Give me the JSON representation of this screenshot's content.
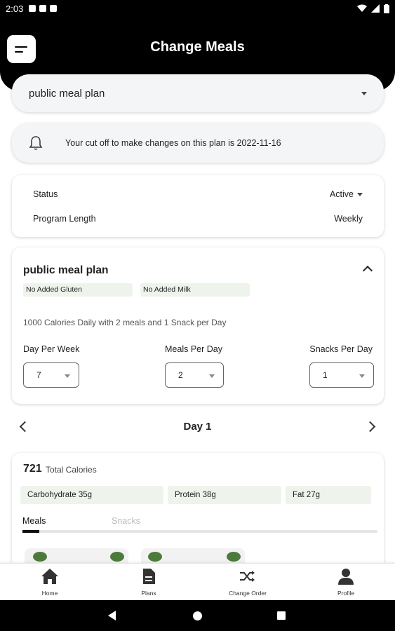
{
  "status_bar": {
    "time": "2:03"
  },
  "header": {
    "title": "Change Meals"
  },
  "plan_select": {
    "value": "public meal plan"
  },
  "cutoff": {
    "text": "Your cut off to make changes on this plan is 2022-11-16"
  },
  "status_card": {
    "status_label": "Status",
    "status_value": "Active",
    "length_label": "Program Length",
    "length_value": "Weekly"
  },
  "plan_card": {
    "title": "public meal plan",
    "tags": [
      "No Added Gluten",
      "No Added Milk"
    ],
    "description": "1000 Calories Daily with 2 meals and 1 Snack per Day",
    "fields": [
      {
        "label": "Day Per Week",
        "value": "7"
      },
      {
        "label": "Meals Per Day",
        "value": "2"
      },
      {
        "label": "Snacks Per Day",
        "value": "1"
      }
    ]
  },
  "day_nav": {
    "label": "Day 1"
  },
  "calories": {
    "value": "721",
    "label": "Total Calories",
    "macros": [
      "Carbohydrate 35g",
      "Protein 38g",
      "Fat 27g"
    ],
    "tabs": [
      "Meals",
      "Snacks"
    ]
  },
  "bottom_nav": [
    {
      "label": "Home",
      "icon": "home-icon"
    },
    {
      "label": "Plans",
      "icon": "document-icon"
    },
    {
      "label": "Change Order",
      "icon": "shuffle-icon"
    },
    {
      "label": "Profile",
      "icon": "person-icon"
    }
  ],
  "colors": {
    "header": "#000000",
    "tag_bg": "#eef4ec",
    "pill_bg": "#f4f5f7"
  }
}
